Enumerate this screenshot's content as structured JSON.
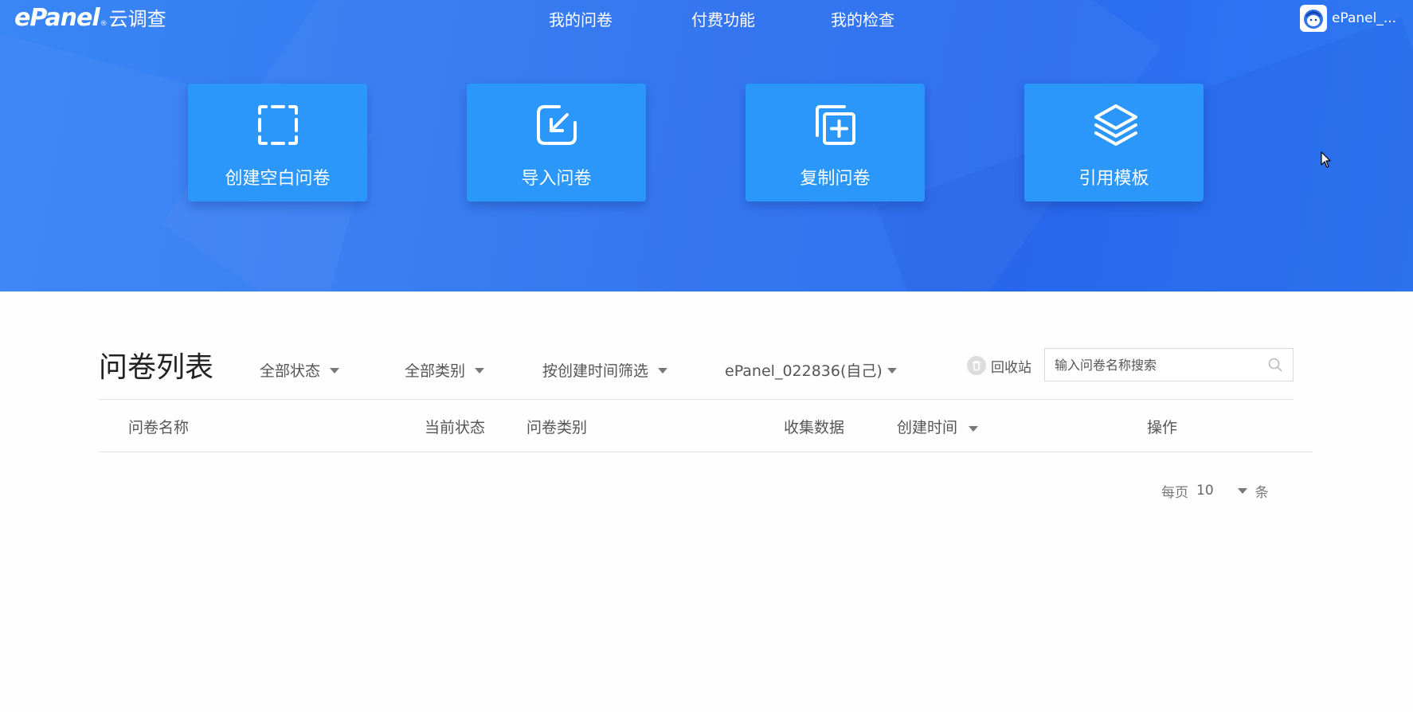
{
  "app": {
    "logo_word": "ePanel",
    "logo_reg": "®",
    "logo_cn": "云调查"
  },
  "nav": {
    "items": [
      {
        "label": "我的问卷"
      },
      {
        "label": "付费功能"
      },
      {
        "label": "我的检查"
      }
    ],
    "user_name": "ePanel_..."
  },
  "actions": [
    {
      "label": "创建空白问卷",
      "icon": "dashed-square-icon"
    },
    {
      "label": "导入问卷",
      "icon": "import-arrow-icon"
    },
    {
      "label": "复制问卷",
      "icon": "copy-plus-icon"
    },
    {
      "label": "引用模板",
      "icon": "layers-icon"
    }
  ],
  "list": {
    "title": "问卷列表",
    "filters": [
      {
        "label": "全部状态"
      },
      {
        "label": "全部类别"
      },
      {
        "label": "按创建时间筛选"
      },
      {
        "label": "ePanel_022836(自己)"
      }
    ],
    "recycle_label": "回收站",
    "search_placeholder": "输入问卷名称搜索",
    "search_value": "",
    "columns": [
      "问卷名称",
      "当前状态",
      "问卷类别",
      "收集数据",
      "创建时间",
      "操作"
    ],
    "rows": []
  },
  "pagination": {
    "prefix": "每页",
    "page_size": "10",
    "suffix": "条"
  },
  "colors": {
    "hero": "#2f74f0",
    "card": "#2b97fb",
    "text": "#555555"
  }
}
